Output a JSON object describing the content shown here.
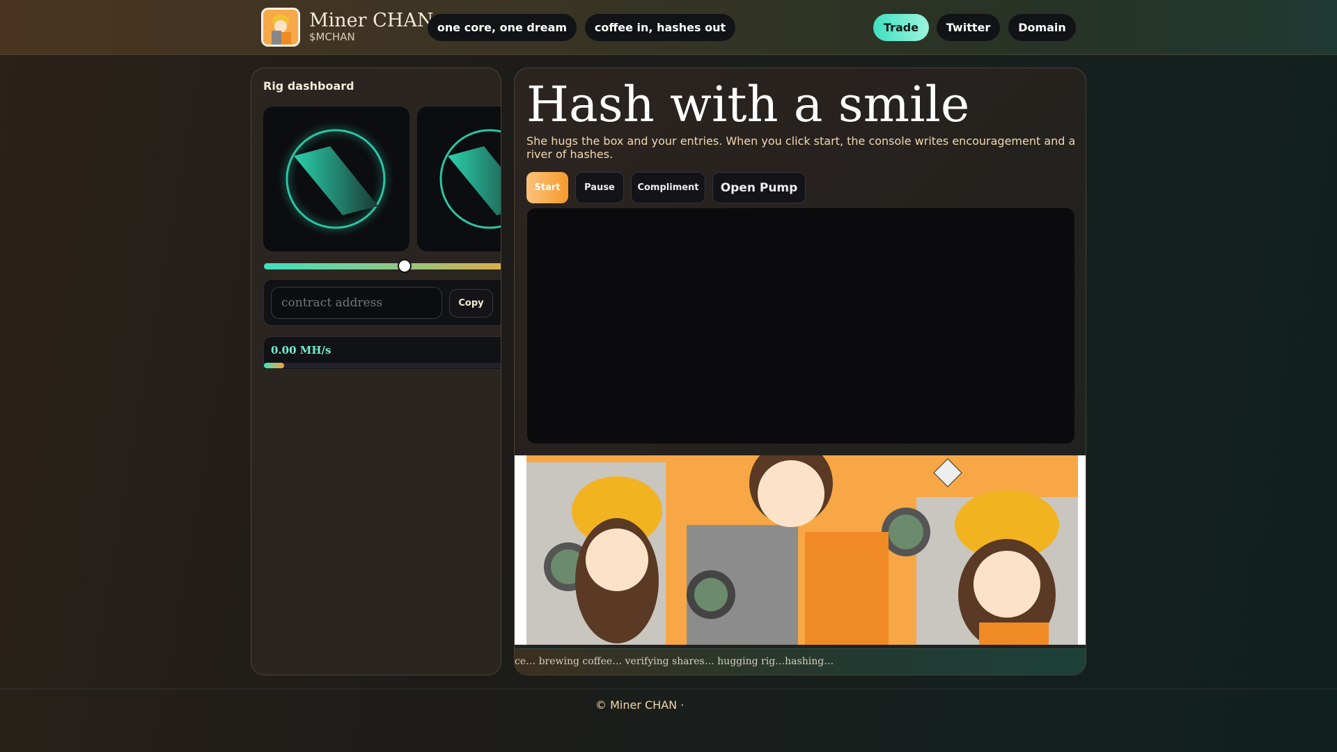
{
  "header": {
    "brand": "Miner CHAN",
    "symbol": "$MCHAN",
    "taglines": [
      "one core, one dream",
      "coffee in, hashes out"
    ],
    "links": {
      "trade": "Trade",
      "twitter": "Twitter",
      "domain": "Domain"
    }
  },
  "dashboard": {
    "title": "Rig dashboard",
    "slider_value_fraction": 0.56,
    "contract_placeholder": "contract address",
    "copy_label": "Copy",
    "hashrate": "0.00 MH/s",
    "hash_progress_fraction": 0.08
  },
  "main": {
    "title": "Hash with a smile",
    "description": "She hugs the box and your entries. When you click start, the console writes encouragement and a river of hashes.",
    "buttons": {
      "start": "Start",
      "pause": "Pause",
      "compliment": "Compliment",
      "open_pump": "Open Pump"
    },
    "ticker": "ce… brewing coffee… verifying shares… hugging rig…hashing…"
  },
  "footer": {
    "text": "© Miner CHAN ·"
  },
  "colors": {
    "accent_teal": "#3fe0c0",
    "accent_orange": "#f7a13a"
  }
}
